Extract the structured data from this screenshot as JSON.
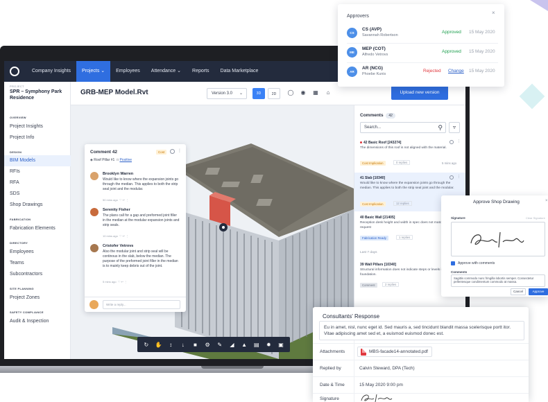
{
  "nav": {
    "items": [
      {
        "label": "Company Insights",
        "active": false
      },
      {
        "label": "Projects ⌄",
        "active": true
      },
      {
        "label": "Employees",
        "active": false
      },
      {
        "label": "Attendance ⌄",
        "active": false
      },
      {
        "label": "Reports",
        "active": false
      },
      {
        "label": "Data Marketplace",
        "active": false
      }
    ]
  },
  "sidebar": {
    "project_caption": "PROJECT",
    "project_name": "SPR – Symphony Park Residence",
    "sections": [
      {
        "title": "OVERVIEW",
        "items": [
          "Project Insights",
          "Project Info"
        ]
      },
      {
        "title": "DESIGN",
        "items": [
          "BIM Models",
          "RFIs",
          "RFA",
          "SDS",
          "Shop Drawings"
        ]
      },
      {
        "title": "FABRICATION",
        "items": [
          "Fabrication Elements"
        ]
      },
      {
        "title": "DIRECTORY",
        "items": [
          "Employees",
          "Teams",
          "Subcontractors"
        ]
      },
      {
        "title": "SITE PLANNING",
        "items": [
          "Project Zones"
        ]
      },
      {
        "title": "SAFETY COMPLIANCE",
        "items": [
          "Audit & Inspection"
        ]
      }
    ],
    "active_item": "BIM Models"
  },
  "header": {
    "model_title": "GRB-MEP Model.Rvt",
    "version": "Version 3.0",
    "view_3d": "3D",
    "view_2d": "2D",
    "upload_label": "Upload new version"
  },
  "comment_card": {
    "title": "Comment 42",
    "tag": "Cost",
    "element": "Roof Pillar #1",
    "element_link": "Positive",
    "comments": [
      {
        "author": "Brooklyn Warren",
        "text": "Would like to know where the expansion joints go through the median. This applies to both the strip seal joint and the modular.",
        "meta": "50 mins ago",
        "color": "#d9a26b"
      },
      {
        "author": "Serenity Fisher",
        "text": "The plans call for a gap and preformed joint filler in the median at the modular expansion joints and strip seals.",
        "meta": "10 mins ago",
        "color": "#c86b3c"
      },
      {
        "author": "Cristofer Vetrovs",
        "text": "Also the modular joint and strip seal will be continous in the slab, below the median. The purpose of the preformed joint filler in the median is to mainly keep debris out of the joint.",
        "meta": "5 mins ago",
        "color": "#a6774f"
      }
    ],
    "reply_placeholder": "Write a reply..."
  },
  "comments_panel": {
    "title": "Comments",
    "count": "42",
    "search_value": "Search...",
    "items": [
      {
        "head": "42  Basic Roof [243274]",
        "body": "The dimensions of this roof is not aligned with the material.",
        "tag": "Cost Implication",
        "tag_kind": "cost",
        "replies": "0 replies",
        "time": "5 mins ago",
        "selected": false,
        "unread": true
      },
      {
        "head": "41  Slab [10340]",
        "body": "Would like to know where the expansion joints go through the median. This applies to both the strip seal joint and the modular.",
        "tag": "Cost Implication",
        "tag_kind": "cost",
        "replies": "12 replies",
        "time": "50 mins ago",
        "selected": true,
        "unread": false
      },
      {
        "head": "40  Basic Wall [21405]",
        "body": "Reception desk height and width in spec does not match initial request",
        "tag": "Fabrication Ready",
        "tag_kind": "fab",
        "replies": "1 replies",
        "time": "6 hrs ago",
        "selected": false,
        "unread": false
      },
      {
        "head": "39  Wall Pillars [10340]",
        "body": "Structural information does not indicate steps or levels in the foundation.",
        "tag": "Comment",
        "tag_kind": "com",
        "replies": "2 replies",
        "time": "12 May",
        "selected": false,
        "unread": false
      }
    ],
    "day_separator": "Last 7 days"
  },
  "approvers": {
    "title": "Approvers",
    "rows": [
      {
        "initials": "CS",
        "role": "CS (AVP)",
        "name": "Savannah Robertson",
        "status": "Approved",
        "date": "15 May 2020",
        "change": ""
      },
      {
        "initials": "ME",
        "role": "MEP (COT)",
        "name": "Alfredo Vetrovs",
        "status": "Approved",
        "date": "15 May 2020",
        "change": ""
      },
      {
        "initials": "AR",
        "role": "AR (NCG)",
        "name": "Phoebe Kunis",
        "status": "Rejected",
        "date": "15 May 2020",
        "change": "Change"
      }
    ]
  },
  "approve_shop": {
    "title": "Approve Shop Drawing",
    "signature_label": "Signature",
    "clear_label": "Clear Signature",
    "checkbox_label": "Approve with comments",
    "comments_label": "Comments",
    "comments_value": "Sagittis commodo nunc fringilla lobortis semper. Consectetur pellentesque condimentum commodo at massa.",
    "cancel_label": "Cancel",
    "approve_label": "Approve"
  },
  "consultants": {
    "title": "Consultants' Response",
    "message": "Eu in amet, nisl, nunc eget id. Sed mauris a, sed tincidunt blandit massa scelerisque portt itor. Vitae adipiscing amet sed et, a euismod euismod donec est.",
    "attachments_label": "Attachments",
    "attachment_file": "MBS-facade14-annotated.pdf",
    "replied_by_label": "Replied by",
    "replied_by_value": "Calvin Steward, DPA (Tech)",
    "datetime_label": "Date & Time",
    "datetime_value": "15 May 2020 9:00 pm",
    "signature_label": "Signature"
  },
  "colors": {
    "nav_bg": "#232b3d",
    "accent": "#2f6ee0",
    "approved": "#1e9f4f",
    "rejected": "#e0383e",
    "cost_tag": "#c77700"
  }
}
